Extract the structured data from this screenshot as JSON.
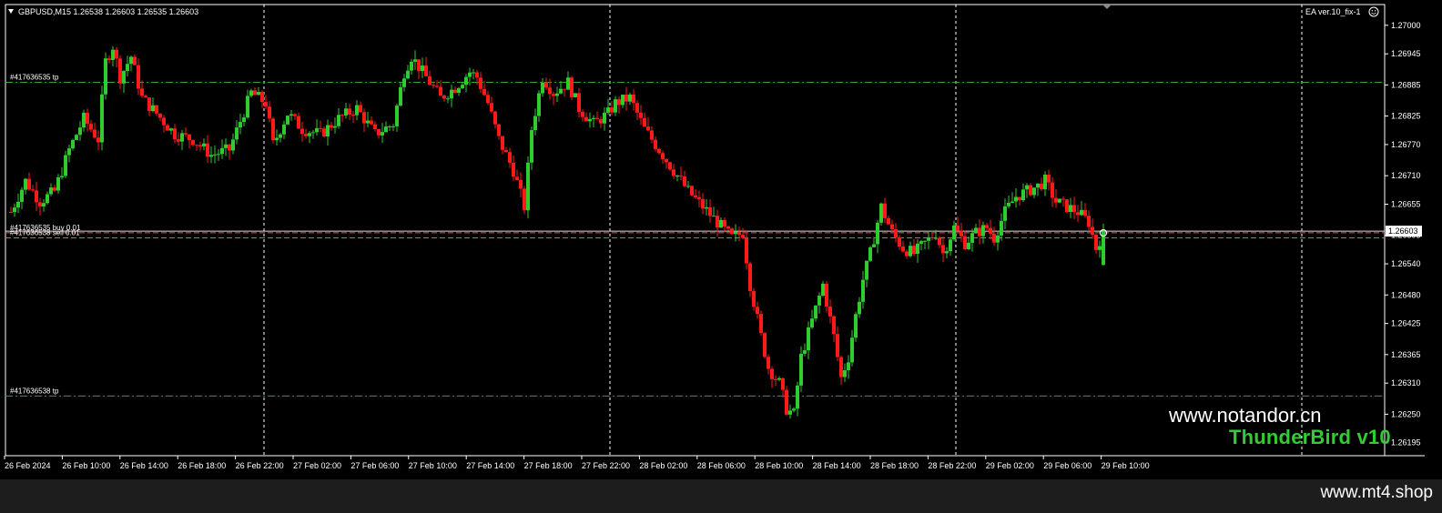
{
  "header": {
    "symbol_info": "GBPUSD,M15  1.26538 1.26603 1.26535 1.26603",
    "ea_label": "EA   ver.10_fix-1"
  },
  "colors": {
    "background": "#000000",
    "bull": "#2ecc2e",
    "bear": "#ff1a1a",
    "grid": "#ffffff",
    "tp_line": "#2ea82e",
    "price_line": "#c86464",
    "frame": "#ffffff"
  },
  "chart_data": {
    "type": "candlestick",
    "title": "",
    "symbol": "GBPUSD",
    "timeframe": "M15",
    "ohlc_last": {
      "open": 1.26538,
      "high": 1.26603,
      "low": 1.26535,
      "close": 1.26603
    },
    "current_price": "1.26603",
    "y_ticks": [
      "1.27000",
      "1.26945",
      "1.26885",
      "1.26825",
      "1.26770",
      "1.26710",
      "1.26655",
      "1.26595",
      "1.26540",
      "1.26480",
      "1.26425",
      "1.26365",
      "1.26310",
      "1.26250",
      "1.26195"
    ],
    "ylim": [
      1.2617,
      1.2704
    ],
    "x_ticks": [
      "26 Feb 2024",
      "26 Feb 10:00",
      "26 Feb 14:00",
      "26 Feb 18:00",
      "26 Feb 22:00",
      "27 Feb 02:00",
      "27 Feb 06:00",
      "27 Feb 10:00",
      "27 Feb 14:00",
      "27 Feb 18:00",
      "27 Feb 22:00",
      "28 Feb 02:00",
      "28 Feb 06:00",
      "28 Feb 10:00",
      "28 Feb 14:00",
      "28 Feb 18:00",
      "28 Feb 22:00",
      "29 Feb 02:00",
      "29 Feb 06:00",
      "29 Feb 10:00"
    ],
    "grid": "vertical dashed day separators",
    "order_lines": [
      {
        "label": "#417636535 tp",
        "price": 1.2689,
        "style": "tp"
      },
      {
        "label": "#417636535 buy 0.01",
        "price": 1.266,
        "style": "entry"
      },
      {
        "label": "#417636538 sell 0.01",
        "price": 1.2659,
        "style": "entry"
      },
      {
        "label": "#417636538 tp",
        "price": 1.26285,
        "style": "tp"
      }
    ],
    "close_path": [
      [
        0,
        1.2664
      ],
      [
        4,
        1.267
      ],
      [
        8,
        1.2666
      ],
      [
        12,
        1.2668
      ],
      [
        16,
        1.2676
      ],
      [
        20,
        1.2682
      ],
      [
        24,
        1.2678
      ],
      [
        26,
        1.2693
      ],
      [
        28,
        1.2696
      ],
      [
        30,
        1.269
      ],
      [
        33,
        1.2694
      ],
      [
        36,
        1.2686
      ],
      [
        40,
        1.2683
      ],
      [
        45,
        1.2679
      ],
      [
        50,
        1.2678
      ],
      [
        55,
        1.2675
      ],
      [
        60,
        1.2676
      ],
      [
        66,
        1.2687
      ],
      [
        70,
        1.2685
      ],
      [
        72,
        1.2677
      ],
      [
        76,
        1.2683
      ],
      [
        80,
        1.268
      ],
      [
        85,
        1.2679
      ],
      [
        90,
        1.2682
      ],
      [
        95,
        1.2684
      ],
      [
        100,
        1.2679
      ],
      [
        105,
        1.2681
      ],
      [
        108,
        1.2691
      ],
      [
        110,
        1.2694
      ],
      [
        114,
        1.269
      ],
      [
        118,
        1.2686
      ],
      [
        122,
        1.2688
      ],
      [
        126,
        1.2691
      ],
      [
        128,
        1.269
      ],
      [
        131,
        1.2685
      ],
      [
        134,
        1.2678
      ],
      [
        138,
        1.2672
      ],
      [
        141,
        1.2665
      ],
      [
        143,
        1.268
      ],
      [
        146,
        1.269
      ],
      [
        149,
        1.2687
      ],
      [
        153,
        1.2689
      ],
      [
        156,
        1.2684
      ],
      [
        160,
        1.2681
      ],
      [
        164,
        1.2683
      ],
      [
        166,
        1.2685
      ],
      [
        170,
        1.2686
      ],
      [
        174,
        1.268
      ],
      [
        178,
        1.2676
      ],
      [
        182,
        1.2672
      ],
      [
        186,
        1.2668
      ],
      [
        190,
        1.2665
      ],
      [
        194,
        1.2662
      ],
      [
        198,
        1.2659
      ],
      [
        201,
        1.266
      ],
      [
        203,
        1.265
      ],
      [
        206,
        1.264
      ],
      [
        208,
        1.2634
      ],
      [
        211,
        1.2631
      ],
      [
        213,
        1.2626
      ],
      [
        215,
        1.2625
      ],
      [
        217,
        1.2636
      ],
      [
        220,
        1.2643
      ],
      [
        223,
        1.265
      ],
      [
        226,
        1.264
      ],
      [
        228,
        1.2632
      ],
      [
        230,
        1.2636
      ],
      [
        232,
        1.2644
      ],
      [
        234,
        1.2651
      ],
      [
        236,
        1.2656
      ],
      [
        239,
        1.2665
      ],
      [
        242,
        1.266
      ],
      [
        245,
        1.2657
      ],
      [
        248,
        1.2656
      ],
      [
        251,
        1.2658
      ],
      [
        254,
        1.266
      ],
      [
        256,
        1.2656
      ],
      [
        259,
        1.2661
      ],
      [
        262,
        1.2658
      ],
      [
        265,
        1.266
      ],
      [
        268,
        1.2661
      ],
      [
        270,
        1.2659
      ],
      [
        273,
        1.2664
      ],
      [
        276,
        1.2667
      ],
      [
        279,
        1.2668
      ],
      [
        282,
        1.2669
      ],
      [
        284,
        1.267
      ],
      [
        287,
        1.2666
      ],
      [
        290,
        1.2665
      ],
      [
        293,
        1.2664
      ],
      [
        296,
        1.2662
      ],
      [
        298,
        1.2657
      ],
      [
        300,
        1.26603
      ]
    ]
  },
  "watermarks": {
    "line1": "www.notandor.cn",
    "line2": "ThunderBird v10",
    "footer": "www.mt4.shop"
  }
}
